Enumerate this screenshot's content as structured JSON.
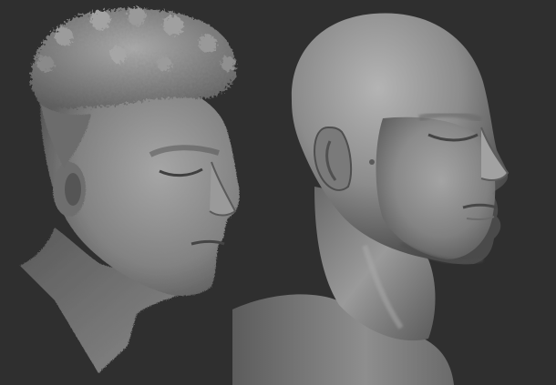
{
  "scene": {
    "background_color": "#2f2f2f",
    "clay_color": "#8f8f8f",
    "models": [
      {
        "id": "scan",
        "description_label": ""
      },
      {
        "id": "sculpt",
        "description_label": ""
      }
    ]
  }
}
